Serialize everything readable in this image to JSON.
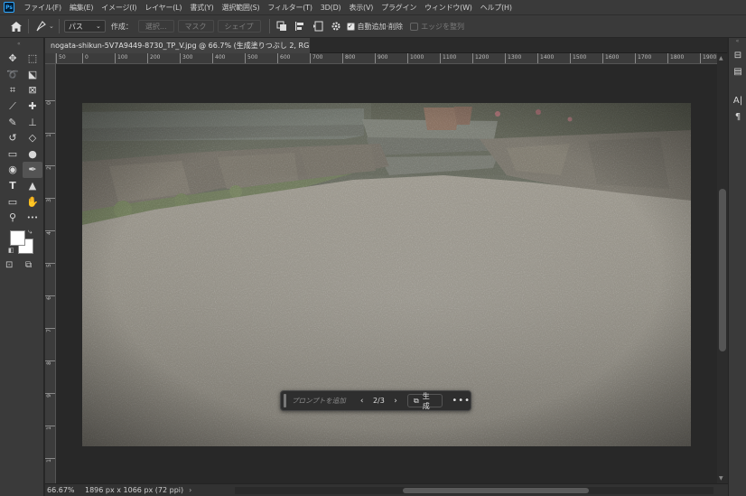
{
  "app": {
    "logo": "Ps",
    "accent": "#31a8ff"
  },
  "menu": [
    "ファイル(F)",
    "編集(E)",
    "イメージ(I)",
    "レイヤー(L)",
    "書式(Y)",
    "選択範囲(S)",
    "フィルター(T)",
    "3D(D)",
    "表示(V)",
    "プラグイン",
    "ウィンドウ(W)",
    "ヘルプ(H)"
  ],
  "options": {
    "home_icon": "home-icon",
    "tool_icon": "pen-icon",
    "mode_value": "パス",
    "create_label": "作成：",
    "buttons": [
      "選択...",
      "マスク",
      "シェイプ"
    ],
    "auto_add_delete_label": "自動追加·削除",
    "auto_add_delete_checked": true,
    "align_edges_label": "エッジを整列",
    "align_edges_checked": false
  },
  "document": {
    "tab_title": "nogata-shikun-5V7A9449-8730_TP_V.jpg @ 66.7% (生成塗りつぶし 2, RGB/8) *",
    "close_symbol": "×"
  },
  "ruler": {
    "top": [
      "50",
      "0",
      "100",
      "200",
      "300",
      "400",
      "500",
      "600",
      "700",
      "800",
      "900",
      "1000",
      "1100",
      "1200",
      "1300",
      "1400",
      "1500",
      "1600",
      "1700",
      "1800",
      "1900"
    ],
    "left": [
      "0",
      "1",
      "2",
      "3",
      "4",
      "5",
      "6",
      "7",
      "8",
      "9",
      "1",
      "1",
      "1"
    ]
  },
  "status": {
    "zoom": "66.67%",
    "info": "1896 px x 1066 px (72 ppi)",
    "more": "›"
  },
  "taskbar": {
    "prompt_placeholder": "プロンプトを追加",
    "prev": "‹",
    "count": "2/3",
    "next": "›",
    "generate_label": "生成",
    "more": "•••"
  },
  "tools": [
    [
      "move-tool-icon",
      "✥"
    ],
    [
      "artboard-tool-icon",
      "⬚"
    ],
    [
      "lasso-tool-icon",
      "➰"
    ],
    [
      "object-select-tool-icon",
      "⬕"
    ],
    [
      "crop-tool-icon",
      "⌗"
    ],
    [
      "frame-tool-icon",
      "⊠"
    ],
    [
      "eyedropper-tool-icon",
      "⟋"
    ],
    [
      "healing-brush-icon",
      "✚"
    ],
    [
      "brush-tool-icon",
      "✎"
    ],
    [
      "stamp-tool-icon",
      "⊥"
    ],
    [
      "history-brush-icon",
      "↺"
    ],
    [
      "eraser-tool-icon",
      "◇"
    ],
    [
      "gradient-tool-icon",
      "▭"
    ],
    [
      "blur-tool-icon",
      "●"
    ],
    [
      "dodge-tool-icon",
      "◉"
    ],
    [
      "pen-tool-icon",
      "✒"
    ],
    [
      "type-tool-icon",
      "T"
    ],
    [
      "path-select-tool-icon",
      "▲"
    ],
    [
      "rectangle-tool-icon",
      "▭"
    ],
    [
      "hand-tool-icon",
      "✋"
    ],
    [
      "zoom-tool-icon",
      "⚲"
    ],
    [
      "more-tools-icon",
      "•••"
    ]
  ],
  "right_dock": [
    [
      "learn-panel-icon",
      "⊟"
    ],
    [
      "comments-panel-icon",
      "▤"
    ],
    [
      "character-panel-icon",
      "A|"
    ],
    [
      "paragraph-panel-icon",
      "¶"
    ]
  ]
}
